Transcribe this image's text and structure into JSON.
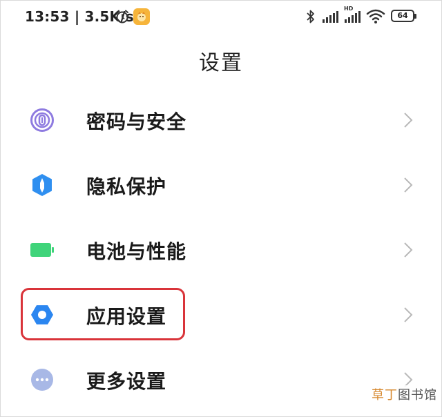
{
  "status_bar": {
    "time_speed": "13:53 | 3.5K/s",
    "hd": "HD",
    "battery": "64"
  },
  "header": {
    "title": "设置"
  },
  "menu": {
    "items": [
      {
        "label": "密码与安全",
        "icon": "fingerprint-icon",
        "color": "#8e7be0"
      },
      {
        "label": "隐私保护",
        "icon": "privacy-shield-icon",
        "color": "#2f8ff0"
      },
      {
        "label": "电池与性能",
        "icon": "battery-icon",
        "color": "#3fd47a"
      },
      {
        "label": "应用设置",
        "icon": "gear-icon",
        "color": "#2b86f0"
      },
      {
        "label": "更多设置",
        "icon": "more-dots-icon",
        "color": "#a8b8e6"
      }
    ]
  },
  "highlight_color": "#d9343a",
  "watermark": {
    "part1": "草丁",
    "part2": "图书馆"
  }
}
